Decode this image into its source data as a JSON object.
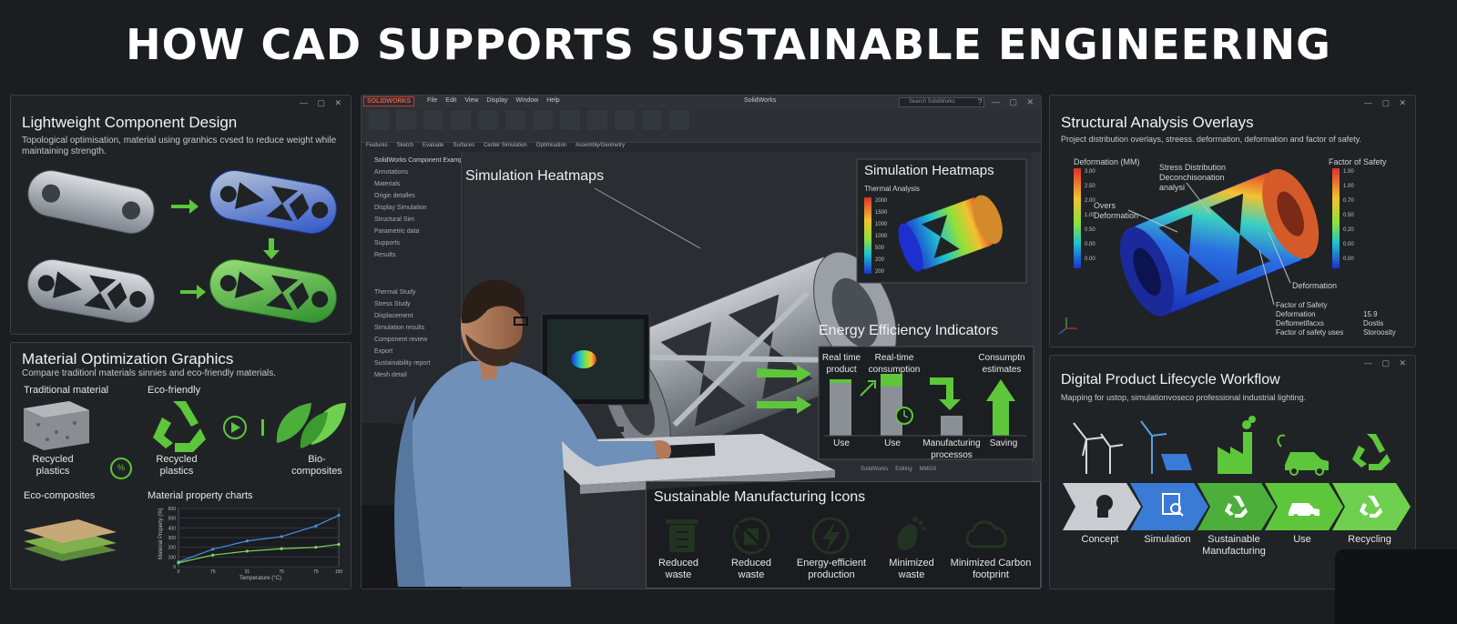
{
  "title": "HOW CAD SUPPORTS SUSTAINABLE ENGINEERING",
  "colors": {
    "green": "#5ec63b",
    "blue": "#3a7bd5",
    "bg": "#1b1d20",
    "panel": "#202326"
  },
  "lightweight": {
    "title": "Lightweight Component Design",
    "subtitle_line1": "Topological optimisation, material using granhics cvsed to reduce weight while",
    "subtitle_line2": "maintaining strength."
  },
  "material": {
    "title": "Material Optimization Graphics",
    "subtitle": "Compare traditionl materials sinnies and eco-friendly materials.",
    "traditional": "Traditional material",
    "ecofriendly": "Eco-friendly",
    "recycled_plastics_1": "Recycled plastics",
    "recycled_plastics_2": "Recycled plastics",
    "biocomposites": "Bio-composites",
    "ecocomposites": "Eco-composites",
    "chart_label": "Material property charts",
    "swap_badge": "%"
  },
  "chart_data": {
    "type": "line",
    "title": "Material property charts",
    "xlabel": "Temperature (°C)",
    "ylabel": "Material Property (%)",
    "x": [
      0,
      75,
      150,
      225,
      300,
      350
    ],
    "x_ticks": [
      "0",
      "75",
      "31",
      "75",
      "75",
      "150"
    ],
    "y_ticks": [
      "0",
      "100",
      "200",
      "300",
      "400",
      "500",
      "600"
    ],
    "ylim": [
      0,
      600
    ],
    "series": [
      {
        "color": "#4a90e2",
        "values": [
          50,
          180,
          265,
          310,
          420,
          530
        ]
      },
      {
        "color": "#7ed957",
        "values": [
          40,
          120,
          160,
          185,
          200,
          230
        ]
      }
    ]
  },
  "cad": {
    "logo": "SOLIDWORKS",
    "menu": [
      "File",
      "Edit",
      "View",
      "Display",
      "Window",
      "Help"
    ],
    "window_title": "SolidWorks",
    "search_placeholder": "Search SolidWorks",
    "tabs": [
      "Features",
      "Sketch",
      "Evaluate",
      "Surfaces",
      "Center Simulation",
      "Optimisation",
      "Assembly/Geometry"
    ],
    "tree_header": "SolidWorks Component Example Details",
    "tree_items": [
      "Annotations",
      "Materials",
      "Origin detalles",
      "Display Simulation",
      "Structural Sim",
      "Parametric data",
      "Supports",
      "Results",
      "Thermal Study",
      "Stress Study",
      "Displacement",
      "Simulation results",
      "Component review",
      "Export",
      "Sustainability report",
      "Mesh detail"
    ],
    "status": [
      "SolidWorks",
      "Editing",
      "MMGS"
    ],
    "heatmap_title": "Simulation Heatmaps",
    "heatmap_popup_title": "Simulation Heatmaps",
    "thermal_label": "Thermal Analysis",
    "thermal_ticks": [
      "2000",
      "1500",
      "1000",
      "1000",
      "500",
      "200",
      "200"
    ],
    "energy": {
      "title": "Energy Efficiency Indicators",
      "col1_top": "Real time product",
      "col2_top": "Real-time consumption",
      "col4_top": "Consumptn estimates",
      "col1_bottom": "Use",
      "col2_bottom": "Use",
      "col3_bottom": "Manufacturing processos",
      "col4_bottom": "Saving"
    },
    "manufacturing": {
      "title": "Sustainable Manufacturing Icons",
      "items": [
        "Reduced waste",
        "Reduced waste",
        "Energy-efficient production",
        "Minimized waste",
        "Minimized Carbon footprint"
      ]
    }
  },
  "structural": {
    "title": "Structural Analysis Overlays",
    "subtitle": "Project distribution overlays, streess. deformation, deformation and factor of safety.",
    "deformation_label": "Deformation (MM)",
    "fos_label": "Factor of Safety",
    "deformation_ticks": [
      "3.00",
      "2.50",
      "2.00",
      "1.00",
      "0.50",
      "0.00",
      "0.00"
    ],
    "fos_ticks": [
      "1.00",
      "1.00",
      "0.70",
      "0.50",
      "0.20",
      "0.00",
      "0.00"
    ],
    "callout_stress": "Stress Distribution Deconchisonation analysi",
    "callout_overs": "Overs Deformation",
    "callout_deformation": "Deformation",
    "results": [
      {
        "label": "Factor of Safety",
        "value": ""
      },
      {
        "label": "Deformation",
        "value": "15.9"
      },
      {
        "label": "Deftometifacxs",
        "value": "Dostis"
      },
      {
        "label": "Factor of safety uses",
        "value": "Storoosity"
      }
    ]
  },
  "lifecycle": {
    "title": "Digital Product Lifecycle Workflow",
    "subtitle": "Mapping for ustop, simulationvoseco professional industrial lighting.",
    "steps": [
      "Concept",
      "Simulation",
      "Sustainable Manufacturing",
      "Use",
      "Recycling"
    ]
  }
}
